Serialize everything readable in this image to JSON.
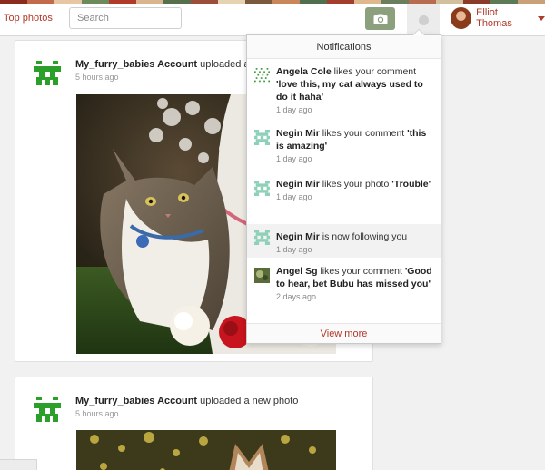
{
  "colors": {
    "brand_red": "#b23a2a",
    "camera_green": "#8ca07e",
    "pixel_green": "#2aa02a",
    "stripe": [
      "#8a2b1d",
      "#c46a4c",
      "#e7c7a3",
      "#6d8a5a",
      "#b23a2a",
      "#d9b48f",
      "#55704a",
      "#9d4e3a",
      "#e4d2b0",
      "#7a5a3a",
      "#c9865a",
      "#4f6f4f",
      "#a33d2e",
      "#e0b88e",
      "#6a7d5c",
      "#b76b4f",
      "#d2c09d",
      "#8b3a2a",
      "#5c7a54",
      "#caa078"
    ]
  },
  "header": {
    "top_photos_label": "Top photos",
    "search_placeholder": "Search",
    "camera_icon": "camera-icon",
    "notifications_icon": "notification-dot-icon",
    "user_name": "Elliot Thomas",
    "caret_icon": "caret-down-icon"
  },
  "feed": [
    {
      "account": "My_furry_babies Account",
      "action": "uploaded a new photo",
      "time": "5 hours ago"
    },
    {
      "account": "My_furry_babies Account",
      "action": "uploaded a new photo",
      "time": "5 hours ago"
    }
  ],
  "notifications": {
    "title": "Notifications",
    "items": [
      {
        "user": "Angela Cole",
        "action": "likes your comment",
        "quote": "'love this, my cat always used to do it haha'",
        "time": "1 day ago",
        "icon": "pixel-avatar-icon"
      },
      {
        "user": "Negin Mir",
        "action": "likes your comment",
        "quote": "'this is amazing'",
        "time": "1 day ago",
        "icon": "pixel-avatar-icon"
      },
      {
        "user": "Negin Mir",
        "action": "likes your photo",
        "quote": "'Trouble'",
        "time": "1 day ago",
        "icon": "pixel-avatar-icon"
      },
      {
        "user": "Negin Mir",
        "action": "is now following you",
        "quote": "",
        "time": "1 day ago",
        "icon": "pixel-avatar-icon"
      },
      {
        "user": "Angel Sg",
        "action": "likes your comment",
        "quote": "'Good to hear, bet Bubu has missed you'",
        "time": "2 days ago",
        "icon": "photo-avatar-icon"
      }
    ],
    "view_more": "View more"
  }
}
